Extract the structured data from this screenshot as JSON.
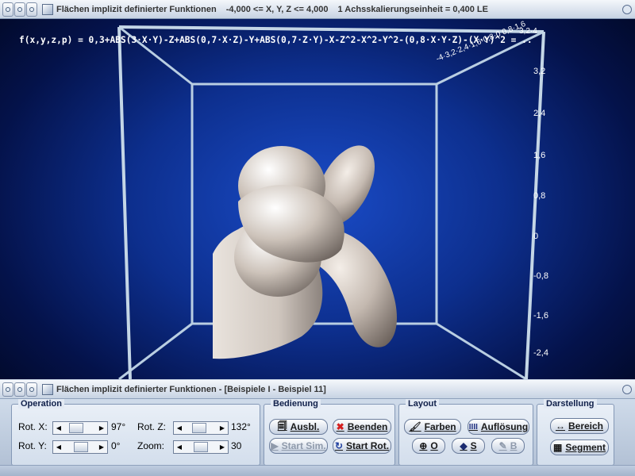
{
  "window": {
    "title_main": "Flächen implizit definierter Funktionen",
    "title_range": "-4,000 <= X, Y, Z <= 4,000",
    "title_scale": "1 Achsskalierungseinheit = 0,400 LE"
  },
  "viewport": {
    "formula": "f(x,y,z,p) = 0,3+ABS(3·X·Y)-Z+ABS(0,7·X·Z)-Y+ABS(0,7·Z·Y)-X-Z^2-X^2-Y^2-(0,8·X·Y·Z)-(X·Y)^2 = ..",
    "y_ticks": [
      "3,2",
      "2,4",
      "1,6",
      "0,8",
      "0",
      "-0,8",
      "-1,6",
      "-2,4"
    ],
    "top_ticks": "-4·3,2·2,4·1,6·0,8·0   0,8·1,6",
    "top_ticks_end": "3,2·4",
    "colors": {
      "box_edge": "#c4d6e6",
      "surface": "#c9bfb6",
      "background": "#0d2f8e"
    }
  },
  "panel": {
    "title": "Flächen implizit definierter Funktionen - [Beispiele I - Beispiel 11]",
    "operation": {
      "legend": "Operation",
      "rot_x_label": "Rot. X:",
      "rot_x_value": "97°",
      "rot_x_fraction": 0.27,
      "rot_y_label": "Rot. Y:",
      "rot_y_value": "0°",
      "rot_y_fraction": 0.5,
      "rot_z_label": "Rot. Z:",
      "rot_z_value": "132°",
      "rot_z_fraction": 0.37,
      "zoom_label": "Zoom:",
      "zoom_value": "30",
      "zoom_fraction": 0.45
    },
    "bedienung": {
      "legend": "Bedienung",
      "ausbl": "Ausbl.",
      "beenden": "Beenden",
      "start_sim": "Start Sim.",
      "start_rot": "Start Rot."
    },
    "layout": {
      "legend": "Layout",
      "farben": "Farben",
      "aufloesung": "Auflösung",
      "o": "O",
      "s": "S",
      "b": "B"
    },
    "darstellung": {
      "legend": "Darstellung",
      "bereich": "Bereich",
      "segment": "Segment"
    }
  }
}
